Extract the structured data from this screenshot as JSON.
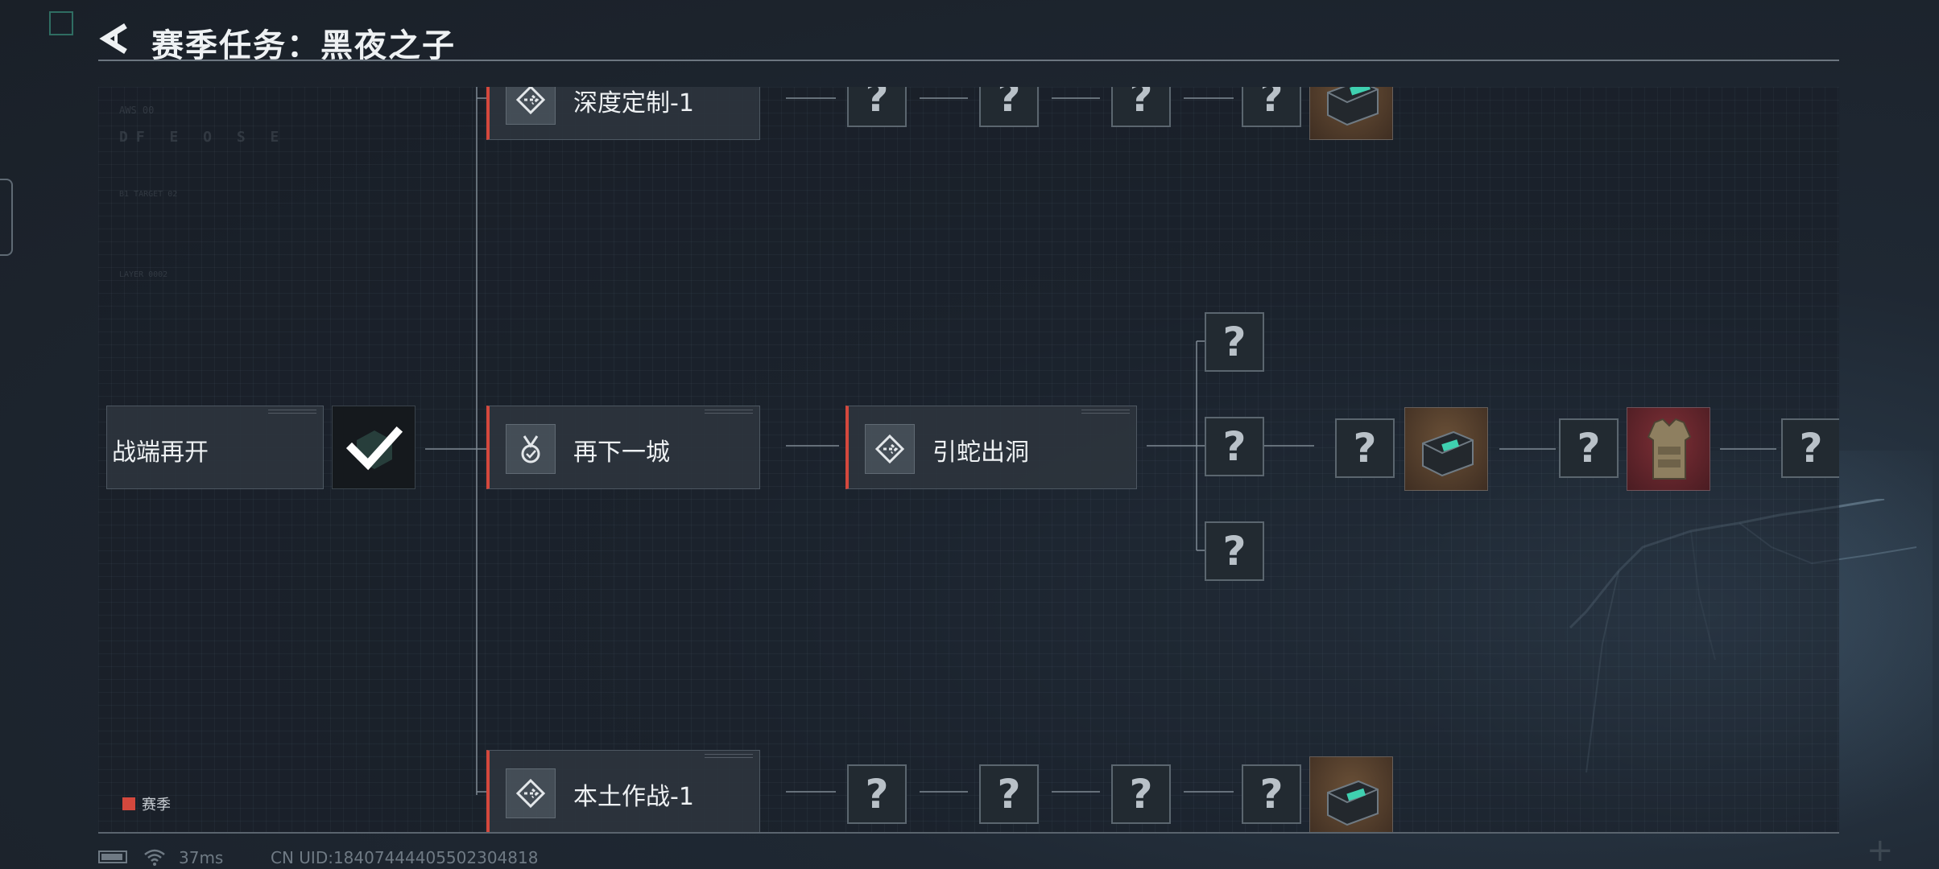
{
  "header": {
    "title": "赛季任务：黑夜之子"
  },
  "legend": {
    "label": "赛季",
    "color": "#d4483d"
  },
  "tasks": {
    "start": {
      "label": "战端再开",
      "status": "completed"
    },
    "deep_custom": {
      "label": "深度定制-1"
    },
    "next_city": {
      "label": "再下一城"
    },
    "lure_snake": {
      "label": "引蛇出洞"
    },
    "homeland": {
      "label": "本土作战-1"
    }
  },
  "mystery_symbol": "?",
  "status_bar": {
    "ping": "37ms",
    "uid": "CN UID:18407444405502304818"
  },
  "rewards": {
    "top_chest": "supply-chest",
    "mid_chest": "supply-chest",
    "mid_armor": "body-armor",
    "bottom_chest": "supply-chest"
  }
}
